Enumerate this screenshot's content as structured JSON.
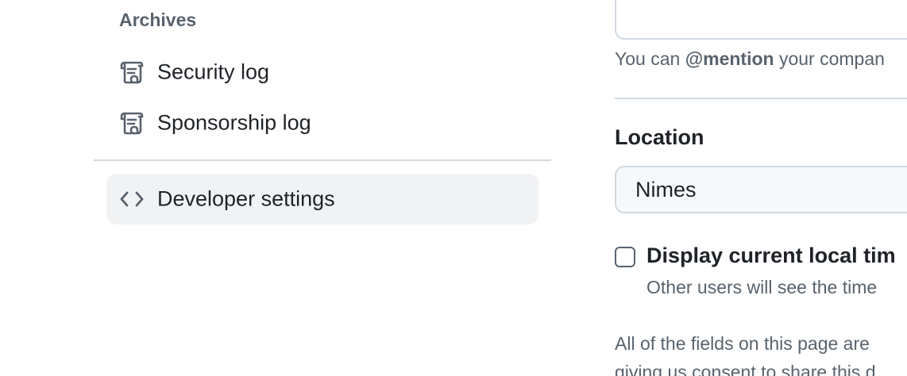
{
  "sidebar": {
    "heading": "Archives",
    "items": [
      {
        "label": "Security log",
        "icon": "log-icon"
      },
      {
        "label": "Sponsorship log",
        "icon": "log-icon"
      },
      {
        "label": "Developer settings",
        "icon": "code-icon",
        "active": true
      }
    ]
  },
  "main": {
    "mention_note_prefix": "You can",
    "mention_note_strong": "@mention",
    "mention_note_suffix": "your compan",
    "location": {
      "label": "Location",
      "value": "Nimes"
    },
    "local_time": {
      "label": "Display current local tim",
      "note": "Other users will see the time",
      "checked": false
    },
    "footer": {
      "line1": "All of the fields on this page are",
      "line2": "giving us consent to share this d"
    }
  },
  "colors": {
    "text": "#1f2328",
    "muted": "#59636e",
    "border": "#d1d9e0",
    "active_bg": "#f1f2f4",
    "input_bg": "#f6f8fa"
  }
}
